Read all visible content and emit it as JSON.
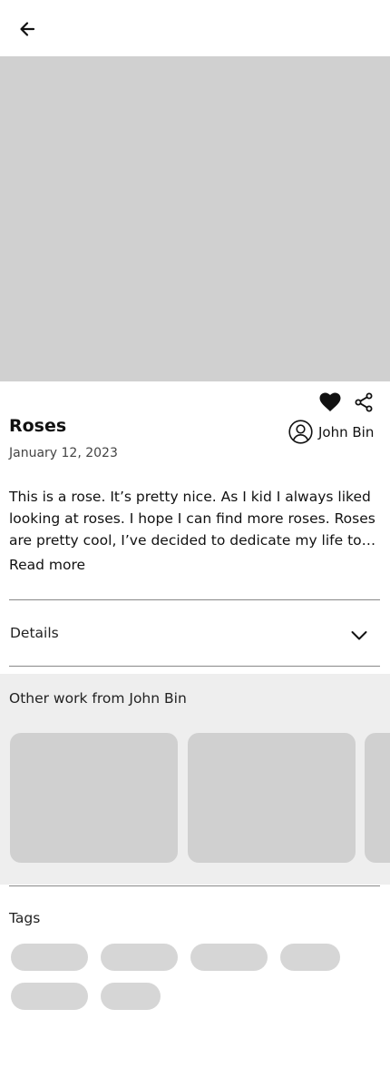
{
  "header": {
    "back_icon": "arrow-left-icon"
  },
  "hero": {
    "image_icon": "image-placeholder"
  },
  "actions": {
    "favorite_icon": "heart-icon",
    "share_icon": "share-icon"
  },
  "post": {
    "title": "Roses",
    "date": "January 12, 2023",
    "description": "This is a rose. It’s pretty nice. As I kid I always liked looking at roses. I hope I can find more roses. Roses are pretty cool, I’ve decided to dedicate my life to…",
    "read_more": "Read more"
  },
  "author": {
    "name": "John Bin",
    "avatar_icon": "user-circle-icon"
  },
  "details": {
    "label": "Details",
    "chevron_icon": "chevron-down-icon"
  },
  "other_work": {
    "title": "Other work from John Bin",
    "card_count": 3
  },
  "tags": {
    "title": "Tags",
    "tag_count": 6
  },
  "colors": {
    "placeholder": "#d0d0d0",
    "section_bg": "#eeeeee",
    "tag_bg": "#d6d6d6",
    "divider": "#888888"
  }
}
